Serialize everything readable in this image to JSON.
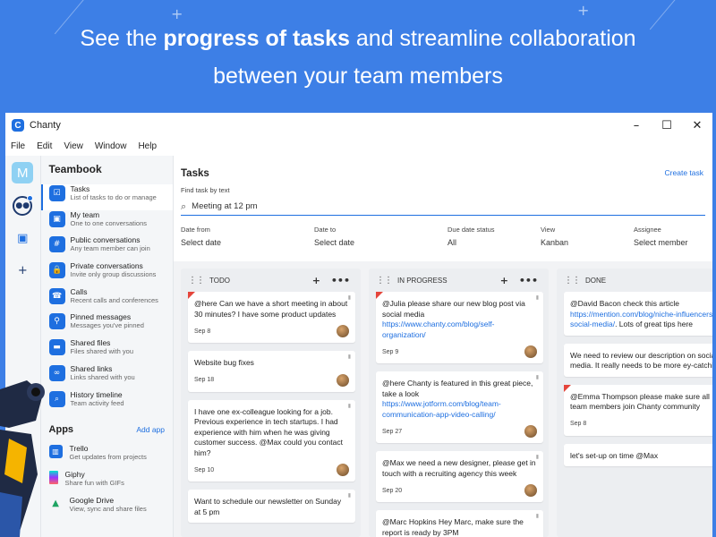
{
  "headline": {
    "part1": "See the ",
    "bold": "progress of tasks",
    "part2": " and streamline collaboration",
    "line2": "between your team members"
  },
  "window": {
    "title": "Chanty",
    "controls": [
      "–",
      "☐",
      "✕"
    ]
  },
  "menu": [
    "File",
    "Edit",
    "View",
    "Window",
    "Help"
  ],
  "rail": {
    "avatar_letter": "M",
    "icons": [
      "chat-icon",
      "contacts-icon",
      "plus-icon"
    ]
  },
  "sidebar": {
    "team": "Teambook",
    "items": [
      {
        "title": "Tasks",
        "sub": "List of tasks to do or manage",
        "icon": "tasks-icon",
        "glyph": "☑"
      },
      {
        "title": "My team",
        "sub": "One to one conversations",
        "icon": "team-icon",
        "glyph": "▣"
      },
      {
        "title": "Public conversations",
        "sub": "Any team member can join",
        "icon": "hash-icon",
        "glyph": "#"
      },
      {
        "title": "Private conversations",
        "sub": "Invite only group discussions",
        "icon": "lock-icon",
        "glyph": "🔒"
      },
      {
        "title": "Calls",
        "sub": "Recent calls and conferences",
        "icon": "phone-icon",
        "glyph": "☎"
      },
      {
        "title": "Pinned messages",
        "sub": "Messages you've pinned",
        "icon": "pin-icon",
        "glyph": "⚲"
      },
      {
        "title": "Shared files",
        "sub": "Files shared with you",
        "icon": "folder-icon",
        "glyph": "▬"
      },
      {
        "title": "Shared links",
        "sub": "Links shared with you",
        "icon": "link-icon",
        "glyph": "∞"
      },
      {
        "title": "History timeline",
        "sub": "Team activity feed",
        "icon": "search-icon",
        "glyph": "⌕"
      }
    ],
    "apps_title": "Apps",
    "add_app": "Add app",
    "apps": [
      {
        "title": "Trello",
        "sub": "Get updates from projects",
        "icon": "trello-icon"
      },
      {
        "title": "Giphy",
        "sub": "Share fun with GIFs",
        "icon": "giphy-icon"
      },
      {
        "title": "Google Drive",
        "sub": "View, sync and share files",
        "icon": "google-drive-icon"
      }
    ]
  },
  "tasks": {
    "title": "Tasks",
    "create": "Create task",
    "find_label": "Find task by text",
    "search_value": "Meeting at 12 pm",
    "filters": [
      {
        "label": "Date from",
        "value": "Select date"
      },
      {
        "label": "Date to",
        "value": "Select date"
      },
      {
        "label": "Due date status",
        "value": "All"
      },
      {
        "label": "View",
        "value": "Kanban"
      },
      {
        "label": "Assignee",
        "value": "Select member"
      }
    ]
  },
  "columns": [
    {
      "name": "TODO",
      "cards": [
        {
          "text": "@here Can we have a short meeting in about 30 minutes? I have some product updates",
          "link": "",
          "after": "",
          "date": "Sep 8",
          "flag": true
        },
        {
          "text": "Website bug fixes",
          "link": "",
          "after": "",
          "date": "Sep 18",
          "flag": false
        },
        {
          "text": "I have one ex-colleague looking for a job. Previous experience in tech startups. I had experience with him when he was giving customer success. @Max could you contact him?",
          "link": "",
          "after": "",
          "date": "Sep 10",
          "flag": false
        },
        {
          "text": "Want to schedule our newsletter on Sunday at 5 pm",
          "link": "",
          "after": "",
          "date": "",
          "flag": false
        }
      ]
    },
    {
      "name": "IN PROGRESS",
      "cards": [
        {
          "text": "@Julia please share our new blog post via social media ",
          "link": "https://www.chanty.com/blog/self-organization/",
          "after": "",
          "date": "Sep 9",
          "flag": true
        },
        {
          "text": "@here Chanty is featured in this great piece, take a look ",
          "link": "https://www.jotform.com/blog/team-communication-app-video-calling/",
          "after": "",
          "date": "Sep 27",
          "flag": false
        },
        {
          "text": "@Max we need a new designer, please get in touch with a recruiting agency this week",
          "link": "",
          "after": "",
          "date": "Sep 20",
          "flag": false
        },
        {
          "text": "@Marc Hopkins Hey Marc, make sure the report is ready by 3PM",
          "link": "",
          "after": "",
          "date": "",
          "flag": false
        }
      ]
    },
    {
      "name": "DONE",
      "cards": [
        {
          "text": "@David Bacon check this article ",
          "link": "https://mention.com/blog/niche-influencers-social-media/",
          "after": ". Lots of great tips here",
          "date": "",
          "flag": false
        },
        {
          "text": "We need to review our description on social media. It really needs to be more ey-catching",
          "link": "",
          "after": "",
          "date": "",
          "flag": false
        },
        {
          "text": "@Emma Thompson please make sure all team members join Chanty community",
          "link": "",
          "after": "",
          "date": "Sep 8",
          "flag": true
        },
        {
          "text": "let's set-up on time @Max",
          "link": "",
          "after": "",
          "date": "",
          "flag": false
        }
      ]
    }
  ],
  "colors": {
    "accent": "#1e6fe0",
    "background": "#3d7fe6",
    "flag": "#e5453b"
  }
}
